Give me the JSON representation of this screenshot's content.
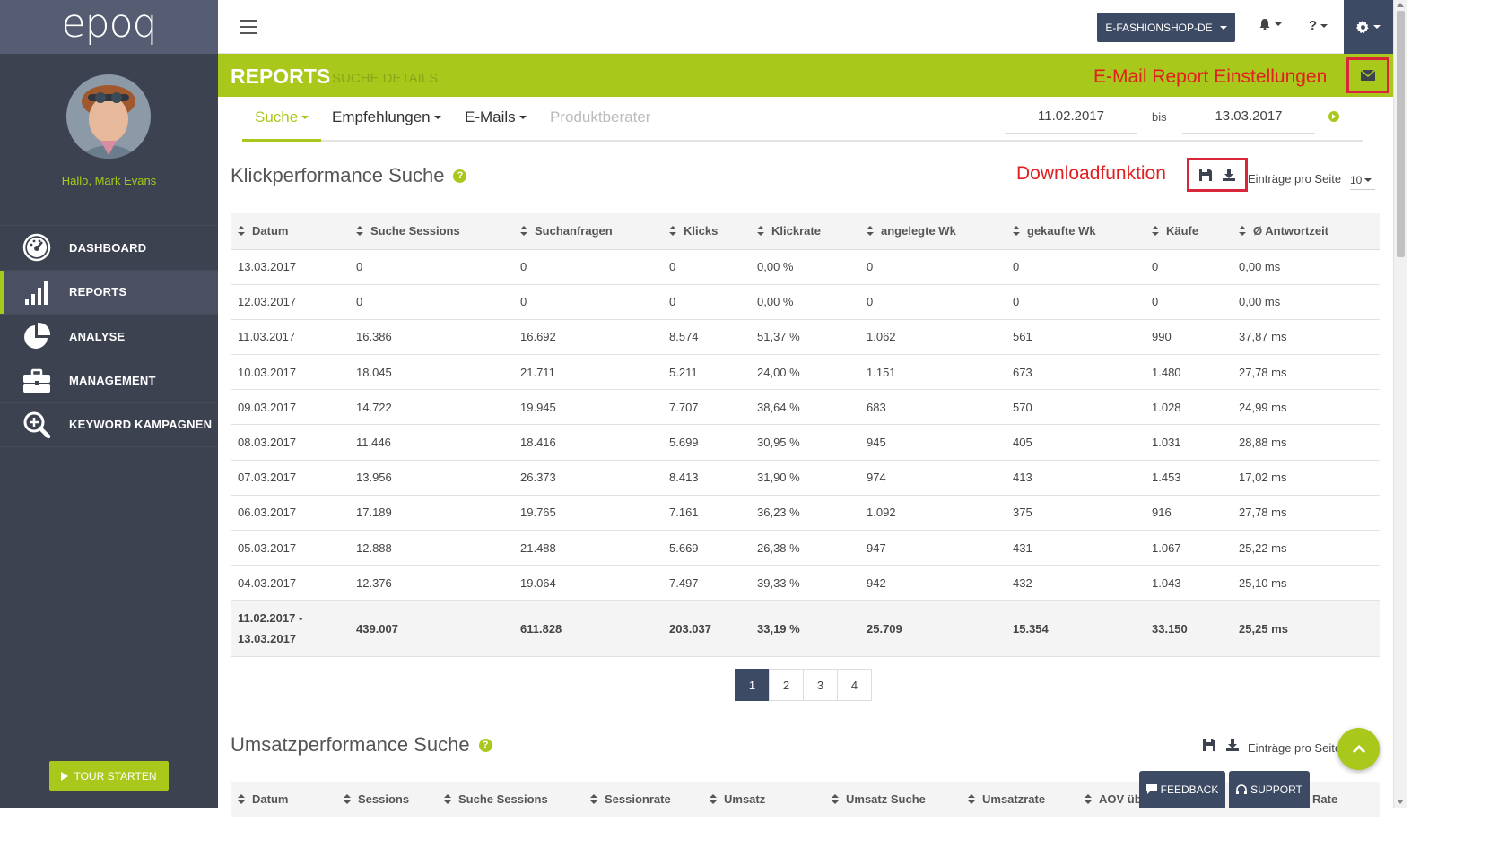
{
  "logo": "epoq",
  "user": {
    "greeting": "Hallo, Mark Evans"
  },
  "nav": [
    {
      "label": "DASHBOARD",
      "icon": "dashboard-gauge-icon",
      "active": false
    },
    {
      "label": "REPORTS",
      "icon": "bar-chart-icon",
      "active": true
    },
    {
      "label": "ANALYSE",
      "icon": "pie-chart-icon",
      "active": false
    },
    {
      "label": "MANAGEMENT",
      "icon": "briefcase-icon",
      "active": false
    },
    {
      "label": "KEYWORD KAMPAGNEN",
      "icon": "search-plus-icon",
      "active": false
    }
  ],
  "tour_button": "TOUR STARTEN",
  "topbar": {
    "shop": "E-FASHIONSHOP-DE",
    "help": "?"
  },
  "header": {
    "title": "REPORTS",
    "subtitle": "SUCHE DETAILS",
    "email_annotation": "E-Mail Report Einstellungen"
  },
  "tabs": [
    {
      "label": "Suche",
      "state": "active",
      "dropdown": true
    },
    {
      "label": "Empfehlungen",
      "state": "normal",
      "dropdown": true
    },
    {
      "label": "E-Mails",
      "state": "normal",
      "dropdown": true
    },
    {
      "label": "Produktberater",
      "state": "disabled",
      "dropdown": false
    }
  ],
  "date_range": {
    "from": "11.02.2017",
    "separator": "bis",
    "to": "13.03.2017"
  },
  "section1": {
    "title": "Klickperformance Suche",
    "download_annotation": "Downloadfunktion",
    "entries_label": "Einträge pro Seite",
    "entries_value": "10",
    "columns": [
      "Datum",
      "Suche Sessions",
      "Suchanfragen",
      "Klicks",
      "Klickrate",
      "angelegte Wk",
      "gekaufte Wk",
      "Käufe",
      "Ø Antwortzeit"
    ],
    "rows": [
      [
        "13.03.2017",
        "0",
        "0",
        "0",
        "0,00 %",
        "0",
        "0",
        "0",
        "0,00 ms"
      ],
      [
        "12.03.2017",
        "0",
        "0",
        "0",
        "0,00 %",
        "0",
        "0",
        "0",
        "0,00 ms"
      ],
      [
        "11.03.2017",
        "16.386",
        "16.692",
        "8.574",
        "51,37 %",
        "1.062",
        "561",
        "990",
        "37,87 ms"
      ],
      [
        "10.03.2017",
        "18.045",
        "21.711",
        "5.211",
        "24,00 %",
        "1.151",
        "673",
        "1.480",
        "27,78 ms"
      ],
      [
        "09.03.2017",
        "14.722",
        "19.945",
        "7.707",
        "38,64 %",
        "683",
        "570",
        "1.028",
        "24,99 ms"
      ],
      [
        "08.03.2017",
        "11.446",
        "18.416",
        "5.699",
        "30,95 %",
        "945",
        "405",
        "1.031",
        "28,88 ms"
      ],
      [
        "07.03.2017",
        "13.956",
        "26.373",
        "8.413",
        "31,90 %",
        "974",
        "413",
        "1.453",
        "17,02 ms"
      ],
      [
        "06.03.2017",
        "17.189",
        "19.765",
        "7.161",
        "36,23 %",
        "1.092",
        "375",
        "916",
        "27,78 ms"
      ],
      [
        "05.03.2017",
        "12.888",
        "21.488",
        "5.669",
        "26,38 %",
        "947",
        "431",
        "1.067",
        "25,22 ms"
      ],
      [
        "04.03.2017",
        "12.376",
        "19.064",
        "7.497",
        "39,33 %",
        "942",
        "432",
        "1.043",
        "25,10 ms"
      ]
    ],
    "total": {
      "date_from": "11.02.2017 -",
      "date_to": "13.03.2017",
      "values": [
        "439.007",
        "611.828",
        "203.037",
        "33,19 %",
        "25.709",
        "15.354",
        "33.150",
        "25,25 ms"
      ]
    },
    "pages": [
      "1",
      "2",
      "3",
      "4"
    ],
    "current_page": "1"
  },
  "section2": {
    "title": "Umsatzperformance Suche",
    "entries_label": "Einträge pro Seite",
    "columns": [
      "Datum",
      "Sessions",
      "Suche Sessions",
      "Sessionrate",
      "Umsatz",
      "Umsatz Suche",
      "Umsatzrate",
      "AOV üb",
      "Rate"
    ]
  },
  "float_buttons": {
    "feedback": "FEEDBACK",
    "support": "SUPPORT"
  },
  "colors": {
    "accent_green": "#a8c81b",
    "sidebar": "#3d4250",
    "navy": "#3d4a63",
    "annotation_red": "#e02020"
  }
}
